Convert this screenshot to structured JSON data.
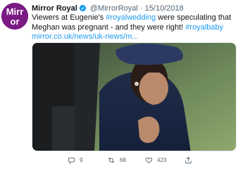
{
  "account": {
    "name": "Mirror Royal",
    "handle": "@MirrorRoyal",
    "separator": "·",
    "date": "15/10/2018",
    "avatar_text_top": "Mirr",
    "avatar_text_bottom": "or"
  },
  "tweet": {
    "text_pre": "Viewers at Eugenie's ",
    "hashtag_1": "#royalwedding",
    "text_mid": " were speculating that Meghan was pregnant - and they were right! ",
    "hashtag_2": "#royalbaby",
    "url": "mirror.co.uk/news/uk-news/m..."
  },
  "actions": {
    "reply_count": "9",
    "retweet_count": "68",
    "like_count": "423"
  },
  "icons": {
    "reply": "reply-icon",
    "retweet": "retweet-icon",
    "like": "heart-icon",
    "share": "share-icon",
    "verified": "verified-badge-icon"
  },
  "colors": {
    "link": "#1d9bf0",
    "secondary_text": "#536471",
    "brand": "#7b1a85"
  }
}
